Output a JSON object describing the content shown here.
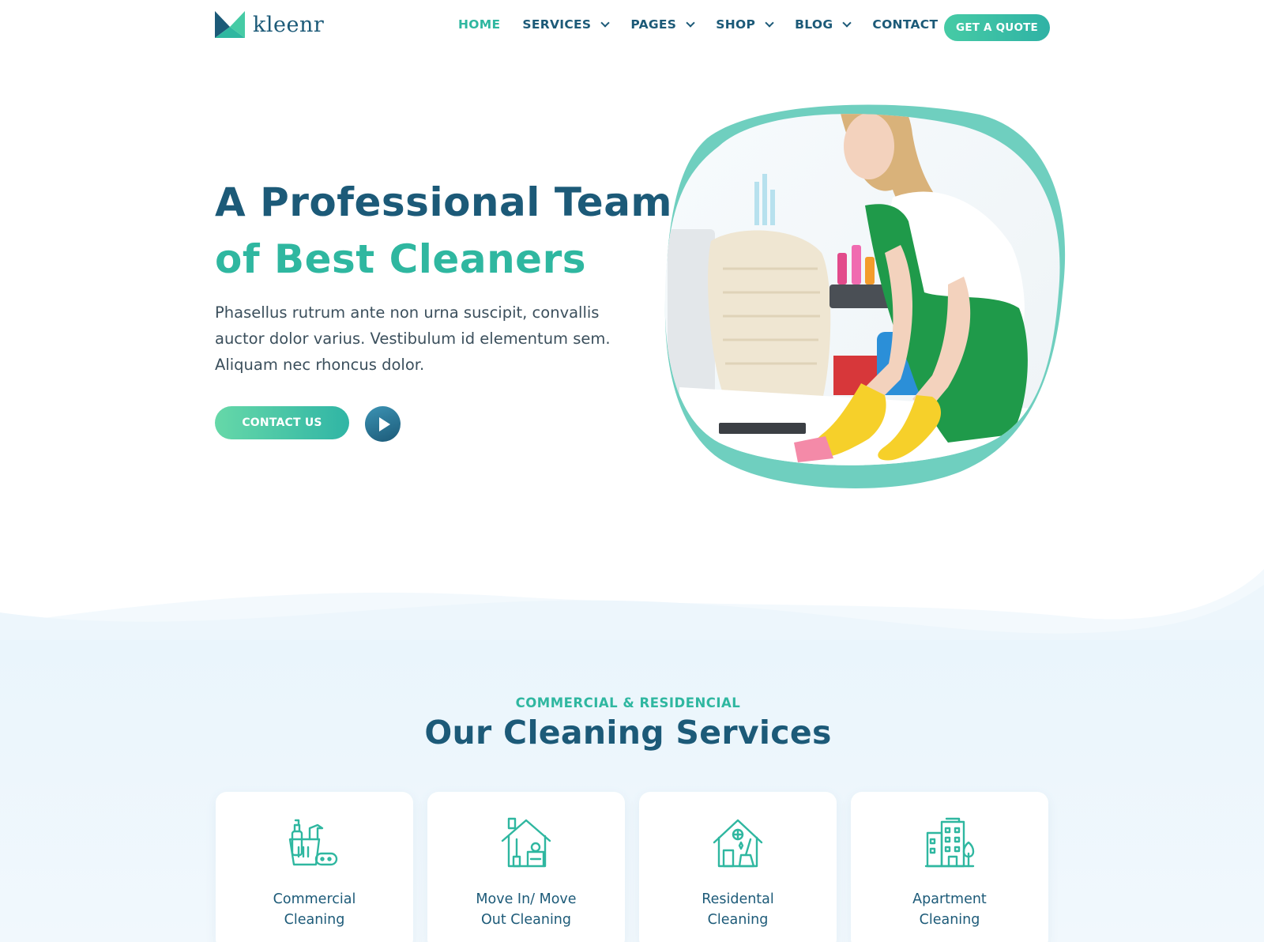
{
  "brand": {
    "name": "kleenr"
  },
  "nav": {
    "items": [
      {
        "label": "HOME"
      },
      {
        "label": "SERVICES"
      },
      {
        "label": "PAGES"
      },
      {
        "label": "SHOP"
      },
      {
        "label": "BLOG"
      },
      {
        "label": "CONTACT"
      }
    ],
    "cta": "GET A QUOTE"
  },
  "hero": {
    "title_line1": "A Professional Team",
    "title_line2": "of Best Cleaners",
    "text": "Phasellus rutrum ante non urna suscipit, convallis auctor dolor varius. Vestibulum id elementum sem. Aliquam nec rhoncus dolor.",
    "button": "CONTACT US"
  },
  "services": {
    "subtitle": "COMMERCIAL & RESIDENCIAL",
    "title": "Our Cleaning Services",
    "cards": [
      {
        "label_line1": "Commercial",
        "label_line2": "Cleaning",
        "icon": "cleaning-supplies-icon"
      },
      {
        "label_line1": "Move In/ Move",
        "label_line2": "Out Cleaning",
        "icon": "house-move-icon"
      },
      {
        "label_line1": "Residental",
        "label_line2": "Cleaning",
        "icon": "house-broom-icon"
      },
      {
        "label_line1": "Apartment",
        "label_line2": "Cleaning",
        "icon": "apartment-building-icon"
      }
    ]
  },
  "colors": {
    "primary": "#1c5a78",
    "accent": "#2fb7a0",
    "section_bg": "#eaf5fc"
  }
}
